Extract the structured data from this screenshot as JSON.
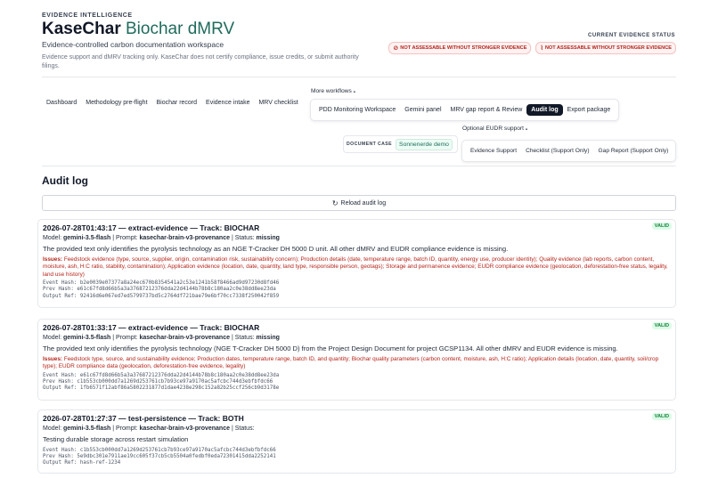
{
  "header": {
    "eyebrow": "EVIDENCE INTELLIGENCE",
    "title_main": "KaseChar",
    "title_accent": "Biochar dMRV",
    "subtitle": "Evidence-controlled carbon documentation workspace",
    "disclaimer": "Evidence support and dMRV tracking only. KaseChar does not certify compliance, issue credits, or submit authority filings."
  },
  "evidence_status": {
    "label": "CURRENT EVIDENCE STATUS",
    "badges": [
      {
        "icon": "⊘",
        "text": "NOT ASSESSABLE WITHOUT STRONGER EVIDENCE"
      },
      {
        "icon": "⌇",
        "text": "NOT ASSESSABLE WITHOUT STRONGER EVIDENCE"
      }
    ]
  },
  "nav": {
    "items": [
      "Dashboard",
      "Methodology pre-flight",
      "Biochar record",
      "Evidence intake",
      "MRV checklist"
    ],
    "more_label": "More workflows",
    "more_items": [
      "PDD Monitoring Workspace",
      "Gemini panel",
      "MRV gap report & Review",
      "Audit log",
      "Export package"
    ],
    "active": "Audit log",
    "eudr_label": "Optional EUDR support",
    "eudr_items": [
      "Evidence Support",
      "Checklist (Support Only)",
      "Gap Report (Support Only)"
    ]
  },
  "document_case": {
    "label": "DOCUMENT CASE",
    "value": "Sonnenerde demo"
  },
  "audit": {
    "title": "Audit log",
    "reload_label": "Reload audit log",
    "entries": [
      {
        "title": "2026-07-28T01:43:17 — extract-evidence — Track: BIOCHAR",
        "model_label": "Model:",
        "model": "gemini-3.5-flash",
        "prompt_label": "Prompt:",
        "prompt": "kasechar-brain-v3-provenance",
        "status_label": "Status:",
        "status": "missing",
        "badge": "VALID",
        "summary": "The provided text only identifies the pyrolysis technology as an NGE T-Cracker DH 5000 D unit. All other dMRV and EUDR compliance evidence is missing.",
        "issues_label": "Issues:",
        "issues": "Feedstock evidence (type, source, supplier, origin, contamination risk, sustainability concern); Production details (date, temperature range, batch ID, quantity, energy use, producer identity); Quality evidence (lab reports, carbon content, moisture, ash, H:C ratio, stability, contamination); Application evidence (location, date, quantity, land type, responsible person, geotags); Storage and permanence evidence; EUDR compliance evidence (geolocation, deforestation-free status, legality, land use history)",
        "hashes": [
          "Event Hash: b2e0039e07377a8a24ec670b8354541a2c53e1241b58f8466ad9d97230d8fd46",
          "Prev Hash:  e61c67fd8d66b5a3a37687212376dda22d4144b78b8c180aa2c0e38dd8ee23da",
          "Output Ref: 92416d6e067ed7ed5799737bd5c2764df721bae79e6bf70cc7338f250042f859"
        ]
      },
      {
        "title": "2026-07-28T01:33:17 — extract-evidence — Track: BIOCHAR",
        "model_label": "Model:",
        "model": "gemini-3.5-flash",
        "prompt_label": "Prompt:",
        "prompt": "kasechar-brain-v3-provenance",
        "status_label": "Status:",
        "status": "missing",
        "badge": "VALID",
        "summary": "The provided text only identifies the pyrolysis technology (NGE T-Cracker DH 5000 D) from the Project Design Document for project GCSP1134. All other dMRV and EUDR evidence is missing.",
        "issues_label": "Issues:",
        "issues": "Feedstock type, source, and sustainability evidence; Production dates, temperature range, batch ID, and quantity; Biochar quality parameters (carbon content, moisture, ash, H:C ratio); Application details (location, date, quantity, soil/crop type); EUDR compliance data (geolocation, deforestation-free evidence, legality)",
        "hashes": [
          "Event Hash: e61c67fd8d66b5a3a37687212376dda22d4144b78b8c180aa2c0e38dd8ee23da",
          "Prev Hash:  c1b553cb000dd7a1269d253761cb7b93ce97a9170ac5afcbc744d3ebfbfdc66",
          "Output Ref: 1fb6571f12abf86a5802231877d1dae4238e298c152a82b25ccf256cb9d3178e"
        ]
      },
      {
        "title": "2026-07-28T01:27:37 — test-persistence — Track: BOTH",
        "model_label": "Model:",
        "model": "gemini-3.5-flash",
        "prompt_label": "Prompt:",
        "prompt": "kasechar-brain-v3-provenance",
        "status_label": "Status:",
        "status": "",
        "badge": "VALID",
        "summary": "Testing durable storage across restart simulation",
        "issues_label": "",
        "issues": "",
        "hashes": [
          "Event Hash: c1b553cb000dd7a1269d253761cb7b93ce97a9170ac5afcbc744d3ebfbfdc66",
          "Prev Hash:  5e9dbc301e7911ae19cc605f37cb5cb5504a0fedbf0eda72301415dda2252141",
          "Output Ref: hash-ref-1234"
        ]
      }
    ]
  }
}
